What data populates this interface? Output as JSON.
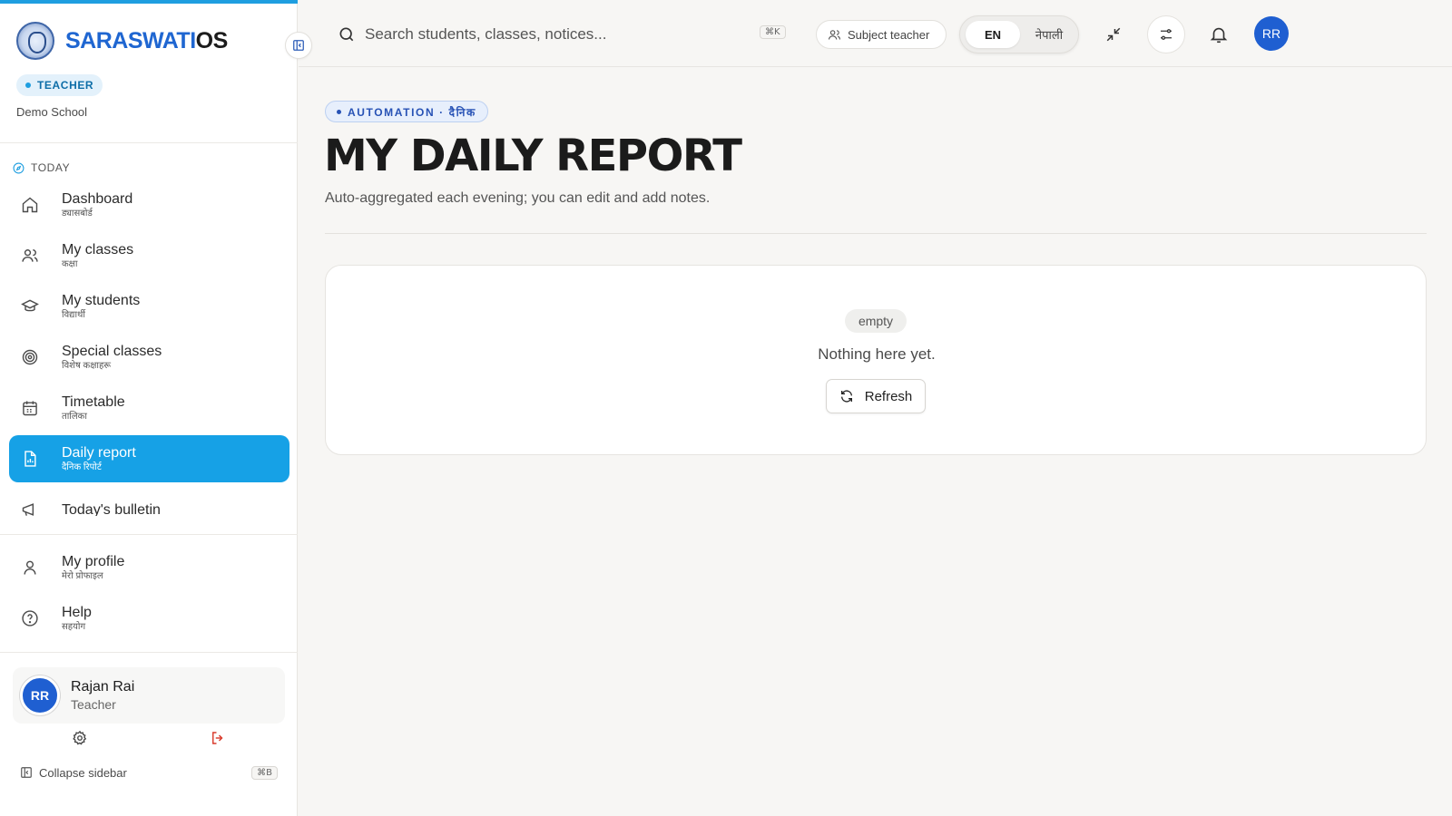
{
  "brand": {
    "name_part1": "SARASWATI",
    "name_part2": "OS"
  },
  "sidebar": {
    "role_badge": "TEACHER",
    "school": "Demo School",
    "section_title": "TODAY",
    "items": [
      {
        "label": "Dashboard",
        "label_np": "ड्यासबोर्ड",
        "icon": "home-icon"
      },
      {
        "label": "My classes",
        "label_np": "कक्षा",
        "icon": "users-icon"
      },
      {
        "label": "My students",
        "label_np": "विद्यार्थी",
        "icon": "graduation-cap-icon"
      },
      {
        "label": "Special classes",
        "label_np": "विशेष कक्षाहरू",
        "icon": "target-icon"
      },
      {
        "label": "Timetable",
        "label_np": "तालिका",
        "icon": "calendar-icon"
      },
      {
        "label": "Daily report",
        "label_np": "दैनिक रिपोर्ट",
        "icon": "report-icon",
        "active": true
      },
      {
        "label": "Today's bulletin",
        "label_np": "",
        "icon": "megaphone-icon"
      }
    ],
    "secondary_items": [
      {
        "label": "My profile",
        "label_np": "मेरो प्रोफाइल",
        "icon": "user-icon"
      },
      {
        "label": "Help",
        "label_np": "सहयोग",
        "icon": "help-icon"
      }
    ],
    "user": {
      "initials": "RR",
      "name": "Rajan Rai",
      "role": "Teacher"
    },
    "collapse_label": "Collapse sidebar",
    "collapse_shortcut": "⌘B"
  },
  "header": {
    "search_placeholder": "Search students, classes, notices...",
    "search_shortcut": "⌘K",
    "role_pill": "Subject teacher",
    "lang_en": "EN",
    "lang_np": "नेपाली",
    "avatar_initials": "RR"
  },
  "main": {
    "eyebrow": "AUTOMATION · दैनिक",
    "title": "MY DAILY REPORT",
    "subtitle": "Auto-aggregated each evening; you can edit and add notes.",
    "empty_tag": "empty",
    "empty_text": "Nothing here yet.",
    "refresh_label": "Refresh"
  },
  "colors": {
    "accent": "#16a1e6",
    "brand_blue": "#1f66d1",
    "avatar_blue": "#1f5fd1",
    "logout_red": "#d93a2b"
  }
}
